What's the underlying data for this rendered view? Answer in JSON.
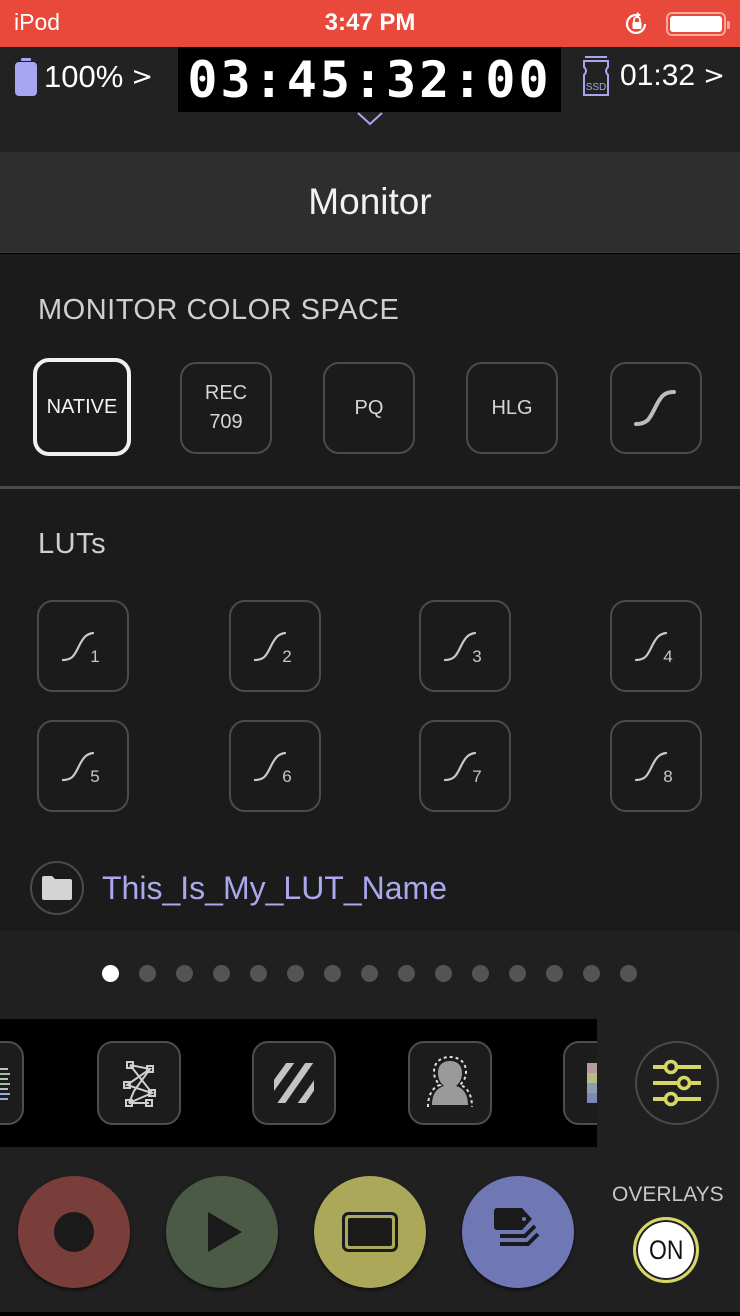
{
  "status_bar": {
    "carrier": "iPod",
    "time": "3:47 PM",
    "icons": [
      "orientation-lock-icon",
      "battery-icon"
    ],
    "color": "#e8493b"
  },
  "header": {
    "battery_percent": "100%",
    "battery_chevron": ">",
    "timecode": "03:45:32:00",
    "media_remaining": "01:32",
    "media_chevron": ">",
    "media_icon_label": "SSD",
    "accent_color": "#a8a6f0"
  },
  "page": {
    "title": "Monitor"
  },
  "monitor_color_space": {
    "label": "MONITOR COLOR SPACE",
    "options": [
      {
        "label": "NATIVE",
        "selected": true
      },
      {
        "label": "REC\n709",
        "line1": "REC",
        "line2": "709",
        "selected": false
      },
      {
        "label": "PQ",
        "selected": false
      },
      {
        "label": "HLG",
        "selected": false
      },
      {
        "label": "",
        "icon": "curve-icon",
        "selected": false
      }
    ]
  },
  "luts": {
    "label": "LUTs",
    "slots": [
      "1",
      "2",
      "3",
      "4",
      "5",
      "6",
      "7",
      "8"
    ],
    "current_lut_name": "This_Is_My_LUT_Name",
    "name_color": "#aba8ee"
  },
  "pagination": {
    "total": 15,
    "active_index": 0
  },
  "tools": [
    {
      "icon": "waveform-icon",
      "partial": true
    },
    {
      "icon": "zebra-pattern-icon"
    },
    {
      "icon": "false-color-stripes-icon"
    },
    {
      "icon": "focus-peaking-person-icon"
    },
    {
      "icon": "color-bars-icon",
      "partial": true
    }
  ],
  "settings_button": {
    "icon": "sliders-icon",
    "color": "#d8d766"
  },
  "bottom_controls": {
    "record": {
      "icon": "record-icon",
      "color": "#7a3e3a"
    },
    "play": {
      "icon": "play-icon",
      "color": "#4b5a45"
    },
    "monitor": {
      "icon": "monitor-frame-icon",
      "color": "#aba85a"
    },
    "tags": {
      "icon": "tags-stack-icon",
      "color": "#6f78b5"
    },
    "overlays_label": "OVERLAYS",
    "overlays_state": "ON"
  }
}
